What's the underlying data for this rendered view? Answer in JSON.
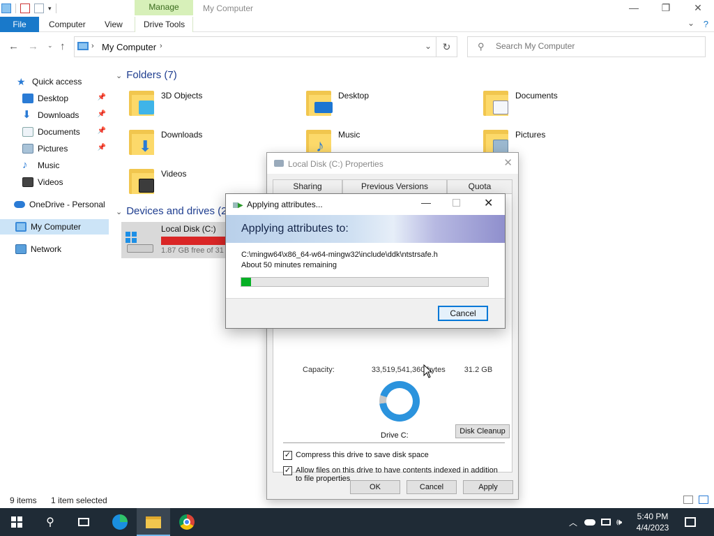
{
  "window": {
    "title": "My Computer",
    "contextual_tab": "Manage"
  },
  "ribbon": {
    "file": "File",
    "tabs": [
      "Computer",
      "View",
      "Drive Tools"
    ]
  },
  "address": {
    "path": "My Computer"
  },
  "search": {
    "placeholder": "Search My Computer"
  },
  "sidebar": {
    "items": [
      {
        "label": "Quick access",
        "icon": "star-icon"
      },
      {
        "label": "Desktop",
        "icon": "desktop-icon",
        "pinned": true
      },
      {
        "label": "Downloads",
        "icon": "download-icon",
        "pinned": true
      },
      {
        "label": "Documents",
        "icon": "document-icon",
        "pinned": true
      },
      {
        "label": "Pictures",
        "icon": "pictures-icon",
        "pinned": true
      },
      {
        "label": "Music",
        "icon": "music-icon"
      },
      {
        "label": "Videos",
        "icon": "videos-icon"
      },
      {
        "label": "OneDrive - Personal",
        "icon": "cloud-icon"
      },
      {
        "label": "My Computer",
        "icon": "computer-icon",
        "selected": true
      },
      {
        "label": "Network",
        "icon": "network-icon"
      }
    ]
  },
  "content": {
    "folders_header": "Folders (7)",
    "folders": [
      {
        "name": "3D Objects",
        "icon": "3d-objects-icon"
      },
      {
        "name": "Desktop",
        "icon": "desktop-folder-icon"
      },
      {
        "name": "Documents",
        "icon": "documents-folder-icon"
      },
      {
        "name": "Downloads",
        "icon": "downloads-folder-icon"
      },
      {
        "name": "Music",
        "icon": "music-folder-icon"
      },
      {
        "name": "Pictures",
        "icon": "pictures-folder-icon"
      },
      {
        "name": "Videos",
        "icon": "videos-folder-icon"
      }
    ],
    "devices_header": "Devices and drives (2)",
    "drive": {
      "name": "Local Disk (C:)",
      "free": "1.87 GB free of 31",
      "used_fraction": 0.94
    }
  },
  "status": {
    "items": "9 items",
    "selected": "1 item selected"
  },
  "properties": {
    "title": "Local Disk (C:) Properties",
    "tabs": [
      "Sharing",
      "Previous Versions",
      "Quota"
    ],
    "capacity_label": "Capacity:",
    "capacity_bytes": "33,519,541,360 bytes",
    "capacity_gb": "31.2 GB",
    "drive_label": "Drive C:",
    "used_fraction": 0.94,
    "disk_cleanup": "Disk Cleanup",
    "compress_label": "Compress this drive to save disk space",
    "compress_checked": true,
    "index_label": "Allow files on this drive to have contents indexed in addition to file properties",
    "index_checked": true,
    "ok": "OK",
    "cancel": "Cancel",
    "apply": "Apply"
  },
  "apply_dialog": {
    "title": "Applying attributes...",
    "heading": "Applying attributes to:",
    "path": "C:\\mingw64\\x86_64-w64-mingw32\\include\\ddk\\ntstrsafe.h",
    "remaining": "About 50 minutes remaining",
    "progress": 0.04,
    "cancel": "Cancel"
  },
  "taskbar": {
    "apps": [
      "start-icon",
      "search-icon",
      "task-view-icon",
      "edge-icon",
      "file-explorer-icon",
      "chrome-icon"
    ],
    "time": "5:40 PM",
    "date": "4/4/2023"
  },
  "colors": {
    "accent": "#1979ca",
    "drive_bar": "#da2626",
    "progress": "#06b025",
    "taskbar": "#1f2b36"
  }
}
